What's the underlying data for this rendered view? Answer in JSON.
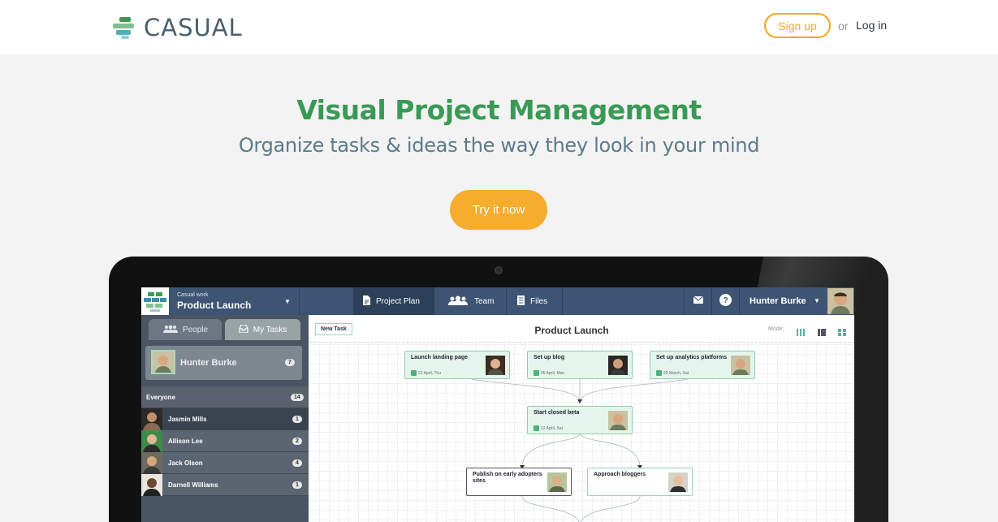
{
  "site": {
    "brand": "CASUAL",
    "signup_label": "Sign up",
    "or_label": "or",
    "login_label": "Log in"
  },
  "hero": {
    "title": "Visual Project Management",
    "subtitle": "Organize tasks & ideas the way they look in your mind",
    "cta_label": "Try it now"
  },
  "colors": {
    "brand_green": "#3a9a55",
    "accent_orange": "#f6ac2c",
    "app_bar": "#3d5473",
    "sidebar": "#4a5564"
  },
  "app": {
    "workspace_label": "Casual work",
    "project_name": "Product Launch",
    "tabs": [
      {
        "label": "Project Plan",
        "icon": "document-icon",
        "active": true
      },
      {
        "label": "Team",
        "icon": "team-icon",
        "active": false
      },
      {
        "label": "Files",
        "icon": "files-icon",
        "active": false
      }
    ],
    "user_name": "Hunter Burke",
    "sidebar": {
      "tab_people": "People",
      "tab_my_tasks": "My Tasks",
      "current_user": {
        "name": "Hunter Burke",
        "count": "7"
      },
      "rows": [
        {
          "label": "Everyone",
          "count": "14"
        },
        {
          "label": "Jasmin Mills",
          "count": "1"
        },
        {
          "label": "Allison Lee",
          "count": "2"
        },
        {
          "label": "Jack Olson",
          "count": "4"
        },
        {
          "label": "Darnell Williams",
          "count": "1"
        }
      ]
    },
    "canvas": {
      "new_task_label": "New Task",
      "title": "Product Launch",
      "mode_label": "Mode:",
      "cards": [
        {
          "title": "Launch landing page",
          "date": "22 April, Thu"
        },
        {
          "title": "Set up blog",
          "date": "05 April, Mon"
        },
        {
          "title": "Set up analytics platforms",
          "date": "29 March, Sat"
        },
        {
          "title": "Start closed beta",
          "date": "12 April, Sat"
        },
        {
          "title": "Publish on early adopters sites",
          "date": ""
        },
        {
          "title": "Approach bloggers",
          "date": ""
        }
      ]
    }
  }
}
